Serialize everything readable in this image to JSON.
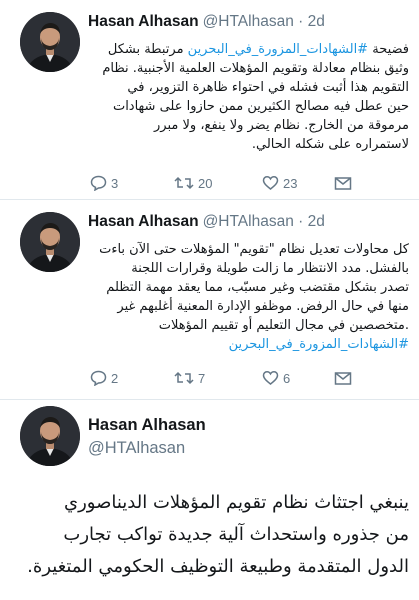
{
  "colors": {
    "link": "#1b95e0",
    "muted": "#657786",
    "divider": "#e1e8ed"
  },
  "tweets": [
    {
      "author_name": "Hasan Alhasan",
      "handle_date": "@HTAlhasan · 2d",
      "lines": [
        "فضيحة ",
        "وثيق بنظام معادلة وتقويم المؤهلات العلمية الأجنبية. نظام",
        "التقويم هذا أثبت فشله في احتواء ظاهرة التزوير، في",
        "حين عطل فيه مصالح الكثيرين ممن حازوا على شهادات",
        "مرموقة من الخارج. نظام يضر ولا ينفع، ولا مبرر",
        "لاستمراره على شكله الحالي."
      ],
      "hashtag": "#الشهادات_المزورة_في_البحرين",
      "hashtag_suffix": " مرتبطة بشكل",
      "replies": "3",
      "retweets": "20",
      "likes": "23"
    },
    {
      "author_name": "Hasan Alhasan",
      "handle_date": "@HTAlhasan · 2d",
      "lines": [
        "كل محاولات تعديل نظام \"تقويم\" المؤهلات حتى الآن باءت",
        "بالفشل. مدد الانتظار ما زالت طويلة وقرارات اللجنة",
        "تصدر بشكل مقتضب وغير مسبّب، مما يعقد مهمة التظلم",
        "منها في حال الرفض. موظفو الإدارة المعنية أغلبهم غير",
        ".متخصصين في مجال التعليم أو تقييم المؤهلات"
      ],
      "hashtag": "#الشهادات_المزورة_في_البحرين",
      "replies": "2",
      "retweets": "7",
      "likes": "6"
    },
    {
      "author_name": "Hasan Alhasan",
      "handle": "@HTAlhasan",
      "lines": [
        "ينبغي اجتثاث نظام تقويم المؤهلات الديناصوري",
        "من جذوره واستحداث آلية جديدة تواكب تجارب",
        "الدول المتقدمة وطبيعة التوظيف الحكومي المتغيرة."
      ]
    }
  ]
}
